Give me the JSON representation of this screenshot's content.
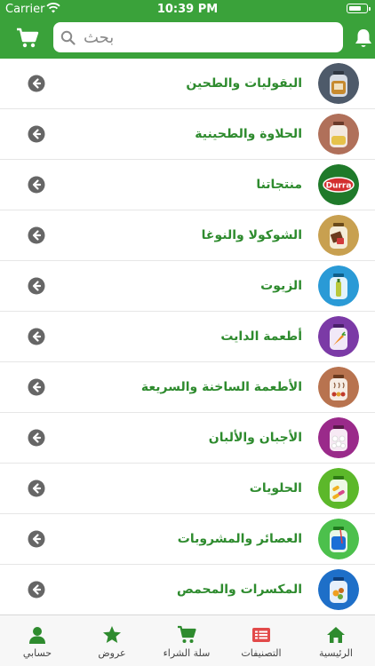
{
  "status_bar": {
    "carrier": "Carrier",
    "time": "10:39 PM"
  },
  "header": {
    "search_placeholder": "بحث",
    "search_value": ""
  },
  "categories": [
    {
      "label": "البقوليات والطحين"
    },
    {
      "label": "الحلاوة والطحينية"
    },
    {
      "label": "منتجاتنا"
    },
    {
      "label": "الشوكولا والنوغا"
    },
    {
      "label": "الزيوت"
    },
    {
      "label": "أطعمة الدايت"
    },
    {
      "label": "الأطعمة الساخنة والسريعة"
    },
    {
      "label": "الأجبان والألبان"
    },
    {
      "label": "الحلويات"
    },
    {
      "label": "العصائر والمشروبات"
    },
    {
      "label": "المكسرات والمحمص"
    }
  ],
  "tabs": [
    {
      "label": "حسابي"
    },
    {
      "label": "عروض"
    },
    {
      "label": "سلة الشراء"
    },
    {
      "label": "التصنيفات"
    },
    {
      "label": "الرئيسية"
    }
  ],
  "logo_text": "Durra",
  "colors": {
    "brand_green": "#3aa23a",
    "label_green": "#2e8b2e",
    "chevron_gray": "#666666"
  }
}
